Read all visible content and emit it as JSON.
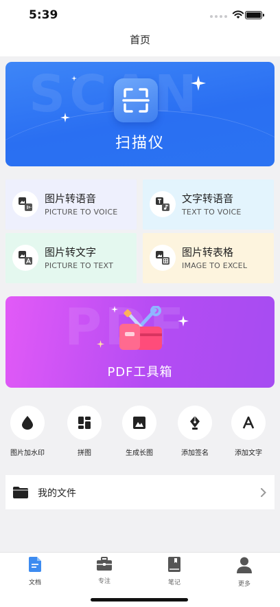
{
  "status_bar": {
    "time": "5:39"
  },
  "nav": {
    "title": "首页"
  },
  "scanner": {
    "label": "扫描仪",
    "watermark": "SCAN"
  },
  "features": [
    {
      "title": "图片转语音",
      "subtitle": "PICTURE TO VOICE",
      "bg": "#eef0fd",
      "icon": "image-to-audio-icon"
    },
    {
      "title": "文字转语音",
      "subtitle": "TEXT TO VOICE",
      "bg": "#e3f4fd",
      "icon": "text-to-audio-icon"
    },
    {
      "title": "图片转文字",
      "subtitle": "PICTURE TO TEXT",
      "bg": "#e4f8ef",
      "icon": "image-to-text-icon"
    },
    {
      "title": "图片转表格",
      "subtitle": "IMAGE TO EXCEL",
      "bg": "#fdf4de",
      "icon": "image-to-table-icon"
    }
  ],
  "pdf_toolbox": {
    "label": "PDF工具箱",
    "watermark": "PDF"
  },
  "tools": [
    {
      "label": "图片加水印",
      "icon": "water-drop-icon"
    },
    {
      "label": "拼图",
      "icon": "collage-icon"
    },
    {
      "label": "生成长图",
      "icon": "long-image-icon"
    },
    {
      "label": "添加签名",
      "icon": "pen-nib-icon"
    },
    {
      "label": "添加文字",
      "icon": "letter-a-icon"
    }
  ],
  "my_files": {
    "label": "我的文件"
  },
  "tabs": [
    {
      "label": "文档",
      "icon": "document-icon",
      "active": true
    },
    {
      "label": "专注",
      "icon": "briefcase-icon",
      "active": false
    },
    {
      "label": "笔记",
      "icon": "notebook-icon",
      "active": false
    },
    {
      "label": "更多",
      "icon": "person-icon",
      "active": false
    }
  ],
  "colors": {
    "scanner_blue": "#2a6ff2",
    "pdf_purple": "#b44cf3",
    "active_tab": "#3d8bf0"
  }
}
